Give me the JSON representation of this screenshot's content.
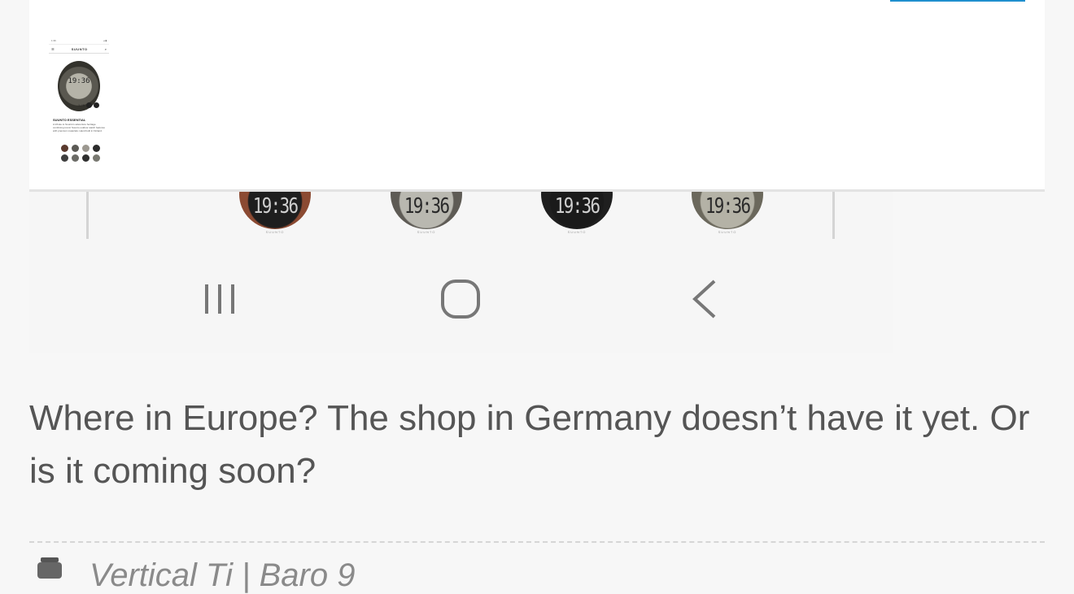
{
  "screenshot": {
    "watches": [
      {
        "time": "19:36",
        "brand": "SUUNTO",
        "bezel": "#8b4a32",
        "face": "#1e1e1e",
        "text": "#cfcfcf"
      },
      {
        "time": "19:36",
        "brand": "SUUNTO",
        "bezel": "#5e5b55",
        "face": "#b9b8b0",
        "text": "#2a2a2a"
      },
      {
        "time": "19:36",
        "brand": "SUUNTO",
        "bezel": "#1f1f1f",
        "face": "#1a1a1a",
        "text": "#d0d0d0"
      },
      {
        "time": "19:36",
        "brand": "SUUNTO",
        "bezel": "#6b685c",
        "face": "#b4b2a6",
        "text": "#2a2a2a"
      }
    ],
    "nav_icons": [
      "recent-apps-icon",
      "home-icon",
      "back-icon"
    ]
  },
  "preview": {
    "status_time": "1:36",
    "status_icons": "◂ ▮",
    "logo": "SUUNTO",
    "watch_time": "19:36",
    "pager": "1 / 5",
    "title": "SUUNTO ESSENTIAL",
    "description": "A tribute to Suunto's adventure heritage combining iconic Suunto outdoor watch features with premium materials. Hand built in Finland.",
    "swatch_colors": [
      "#5a3a2e",
      "#5b5a55",
      "#9c9890",
      "#2b2b2b",
      "#3e3e3e",
      "#6b6b66",
      "#2f2f2f",
      "#787870"
    ],
    "accent": "#1f8fce"
  },
  "post": {
    "text": "Where in Europe? The shop in Germany doesn’t have it yet. Or is it coming soon?"
  },
  "footer": {
    "label": "Vertical Ti | Baro 9"
  }
}
